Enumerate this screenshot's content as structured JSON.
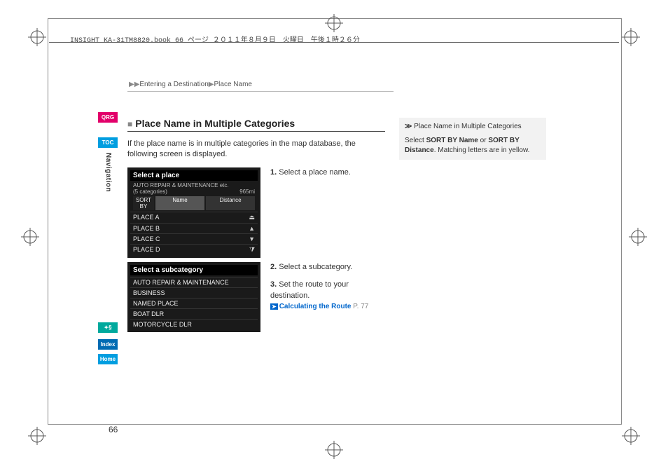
{
  "headerLine": "INSIGHT_KA-31TM8820.book  66 ページ  ２０１１年８月９日　火曜日　午後１時２６分",
  "breadcrumb": {
    "part1": "Entering a Destination",
    "part2": "Place Name"
  },
  "sideTabs": {
    "qrg": "QRG",
    "toc": "TOC",
    "voice": "✦§",
    "index": "Index",
    "home": "Home"
  },
  "verticalLabel": "Navigation",
  "section": {
    "title": "Place Name in Multiple Categories",
    "intro": "If the place name is in multiple categories in the map database, the following screen is displayed."
  },
  "screenshot1": {
    "title": "Select a place",
    "subLeft": "AUTO REPAIR & MAINTENANCE etc.",
    "subRight": "965mi",
    "categoriesNote": "(5 categories)",
    "sortLabel": "SORT BY",
    "tabs": [
      "Name",
      "Distance"
    ],
    "rows": [
      "PLACE A",
      "PLACE B",
      "PLACE C",
      "PLACE D"
    ]
  },
  "screenshot2": {
    "title": "Select a subcategory",
    "rows": [
      "AUTO REPAIR & MAINTENANCE",
      "BUSINESS",
      "NAMED PLACE",
      "BOAT DLR",
      "MOTORCYCLE DLR"
    ]
  },
  "steps": {
    "s1num": "1.",
    "s1text": " Select a place name.",
    "s2num": "2.",
    "s2text": " Select a subcategory.",
    "s3num": "3.",
    "s3text": " Set the route to your destination.",
    "linkLabel": "Calculating the Route",
    "linkPage": "P. 77"
  },
  "sidebar": {
    "title": "Place Name in Multiple Categories",
    "line1a": "Select ",
    "line1b": "SORT BY Name",
    "line1c": " or ",
    "line1d": "SORT BY Distance",
    "line1e": ". Matching letters are in yellow."
  },
  "pageNumber": "66"
}
